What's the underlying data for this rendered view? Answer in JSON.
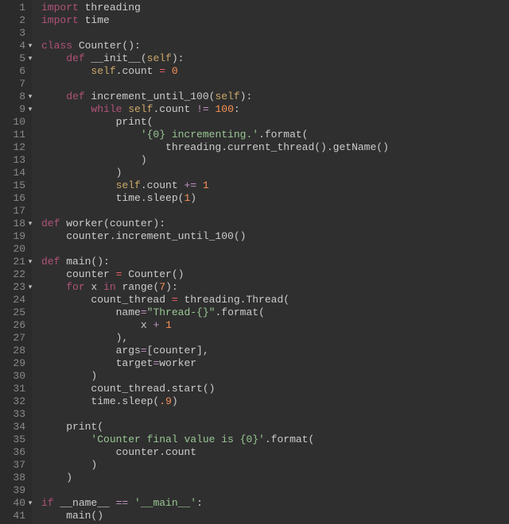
{
  "lines": [
    {
      "num": 1,
      "fold": false,
      "tokens": [
        [
          "kw",
          "import"
        ],
        [
          "",
          " threading"
        ]
      ]
    },
    {
      "num": 2,
      "fold": false,
      "tokens": [
        [
          "kw",
          "import"
        ],
        [
          "",
          " time"
        ]
      ]
    },
    {
      "num": 3,
      "fold": false,
      "tokens": [
        [
          "",
          ""
        ]
      ]
    },
    {
      "num": 4,
      "fold": true,
      "tokens": [
        [
          "kw",
          "class"
        ],
        [
          "",
          " Counter():"
        ]
      ]
    },
    {
      "num": 5,
      "fold": true,
      "tokens": [
        [
          "",
          "    "
        ],
        [
          "kw",
          "def"
        ],
        [
          "",
          " __init__("
        ],
        [
          "self",
          "self"
        ],
        [
          "",
          "):"
        ]
      ]
    },
    {
      "num": 6,
      "fold": false,
      "tokens": [
        [
          "",
          "        "
        ],
        [
          "self",
          "self"
        ],
        [
          "",
          ".count "
        ],
        [
          "assign",
          "="
        ],
        [
          "",
          " "
        ],
        [
          "num",
          "0"
        ]
      ]
    },
    {
      "num": 7,
      "fold": false,
      "tokens": [
        [
          "",
          ""
        ]
      ]
    },
    {
      "num": 8,
      "fold": true,
      "tokens": [
        [
          "",
          "    "
        ],
        [
          "kw",
          "def"
        ],
        [
          "",
          " increment_until_100("
        ],
        [
          "self",
          "self"
        ],
        [
          "",
          "):"
        ]
      ]
    },
    {
      "num": 9,
      "fold": true,
      "tokens": [
        [
          "",
          "        "
        ],
        [
          "kw",
          "while"
        ],
        [
          "",
          " "
        ],
        [
          "self",
          "self"
        ],
        [
          "",
          ".count "
        ],
        [
          "op",
          "!="
        ],
        [
          "",
          " "
        ],
        [
          "num",
          "100"
        ],
        [
          "",
          ":"
        ]
      ]
    },
    {
      "num": 10,
      "fold": false,
      "tokens": [
        [
          "",
          "            print("
        ]
      ]
    },
    {
      "num": 11,
      "fold": false,
      "tokens": [
        [
          "",
          "                "
        ],
        [
          "str",
          "'{0} incrementing.'"
        ],
        [
          "",
          ".format("
        ]
      ]
    },
    {
      "num": 12,
      "fold": false,
      "tokens": [
        [
          "",
          "                    threading.current_thread().getName()"
        ]
      ]
    },
    {
      "num": 13,
      "fold": false,
      "tokens": [
        [
          "",
          "                )"
        ]
      ]
    },
    {
      "num": 14,
      "fold": false,
      "tokens": [
        [
          "",
          "            )"
        ]
      ]
    },
    {
      "num": 15,
      "fold": false,
      "tokens": [
        [
          "",
          "            "
        ],
        [
          "self",
          "self"
        ],
        [
          "",
          ".count "
        ],
        [
          "op",
          "+="
        ],
        [
          "",
          " "
        ],
        [
          "num",
          "1"
        ]
      ]
    },
    {
      "num": 16,
      "fold": false,
      "tokens": [
        [
          "",
          "            time.sleep("
        ],
        [
          "num",
          "1"
        ],
        [
          "",
          ")"
        ]
      ]
    },
    {
      "num": 17,
      "fold": false,
      "tokens": [
        [
          "",
          ""
        ]
      ]
    },
    {
      "num": 18,
      "fold": true,
      "tokens": [
        [
          "kw",
          "def"
        ],
        [
          "",
          " worker(counter):"
        ]
      ]
    },
    {
      "num": 19,
      "fold": false,
      "tokens": [
        [
          "",
          "    counter.increment_until_100()"
        ]
      ]
    },
    {
      "num": 20,
      "fold": false,
      "tokens": [
        [
          "",
          ""
        ]
      ]
    },
    {
      "num": 21,
      "fold": true,
      "tokens": [
        [
          "kw",
          "def"
        ],
        [
          "",
          " main():"
        ]
      ]
    },
    {
      "num": 22,
      "fold": false,
      "tokens": [
        [
          "",
          "    counter "
        ],
        [
          "assign",
          "="
        ],
        [
          "",
          " Counter()"
        ]
      ]
    },
    {
      "num": 23,
      "fold": true,
      "tokens": [
        [
          "",
          "    "
        ],
        [
          "kw",
          "for"
        ],
        [
          "",
          " x "
        ],
        [
          "kw",
          "in"
        ],
        [
          "",
          " range("
        ],
        [
          "num",
          "7"
        ],
        [
          "",
          "):"
        ]
      ]
    },
    {
      "num": 24,
      "fold": false,
      "tokens": [
        [
          "",
          "        count_thread "
        ],
        [
          "assign",
          "="
        ],
        [
          "",
          " threading.Thread("
        ]
      ]
    },
    {
      "num": 25,
      "fold": false,
      "tokens": [
        [
          "",
          "            name"
        ],
        [
          "op",
          "="
        ],
        [
          "str",
          "\"Thread-{}\""
        ],
        [
          "",
          ".format("
        ]
      ]
    },
    {
      "num": 26,
      "fold": false,
      "tokens": [
        [
          "",
          "                x "
        ],
        [
          "op",
          "+"
        ],
        [
          "",
          " "
        ],
        [
          "num",
          "1"
        ]
      ]
    },
    {
      "num": 27,
      "fold": false,
      "tokens": [
        [
          "",
          "            ),"
        ]
      ]
    },
    {
      "num": 28,
      "fold": false,
      "tokens": [
        [
          "",
          "            args"
        ],
        [
          "op",
          "="
        ],
        [
          "",
          "[counter],"
        ]
      ]
    },
    {
      "num": 29,
      "fold": false,
      "tokens": [
        [
          "",
          "            target"
        ],
        [
          "op",
          "="
        ],
        [
          "",
          "worker"
        ]
      ]
    },
    {
      "num": 30,
      "fold": false,
      "tokens": [
        [
          "",
          "        )"
        ]
      ]
    },
    {
      "num": 31,
      "fold": false,
      "tokens": [
        [
          "",
          "        count_thread.start()"
        ]
      ]
    },
    {
      "num": 32,
      "fold": false,
      "tokens": [
        [
          "",
          "        time.sleep("
        ],
        [
          "num",
          ".9"
        ],
        [
          "",
          ")"
        ]
      ]
    },
    {
      "num": 33,
      "fold": false,
      "tokens": [
        [
          "",
          ""
        ]
      ]
    },
    {
      "num": 34,
      "fold": false,
      "tokens": [
        [
          "",
          "    print("
        ]
      ]
    },
    {
      "num": 35,
      "fold": false,
      "tokens": [
        [
          "",
          "        "
        ],
        [
          "str",
          "'Counter final value is {0}'"
        ],
        [
          "",
          ".format("
        ]
      ]
    },
    {
      "num": 36,
      "fold": false,
      "tokens": [
        [
          "",
          "            counter.count"
        ]
      ]
    },
    {
      "num": 37,
      "fold": false,
      "tokens": [
        [
          "",
          "        )"
        ]
      ]
    },
    {
      "num": 38,
      "fold": false,
      "tokens": [
        [
          "",
          "    )"
        ]
      ]
    },
    {
      "num": 39,
      "fold": false,
      "tokens": [
        [
          "",
          ""
        ]
      ]
    },
    {
      "num": 40,
      "fold": true,
      "tokens": [
        [
          "kw",
          "if"
        ],
        [
          "",
          " __name__ "
        ],
        [
          "op",
          "=="
        ],
        [
          "",
          " "
        ],
        [
          "str",
          "'__main__'"
        ],
        [
          "",
          ":"
        ]
      ]
    },
    {
      "num": 41,
      "fold": false,
      "tokens": [
        [
          "",
          "    main()"
        ]
      ]
    }
  ]
}
